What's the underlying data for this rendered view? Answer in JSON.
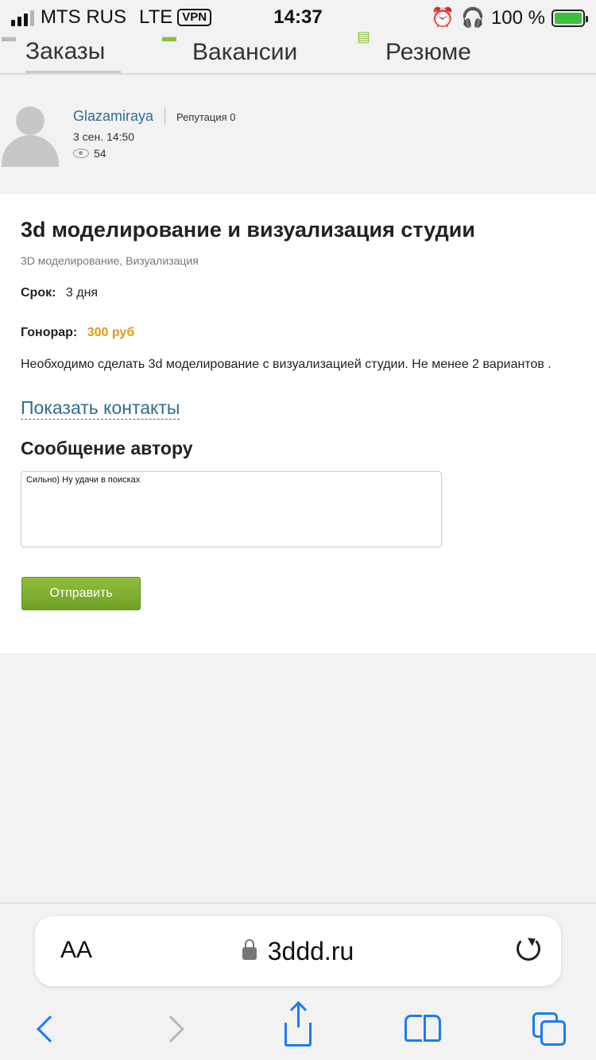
{
  "status_bar": {
    "carrier": "MTS RUS",
    "network": "LTE",
    "vpn": "VPN",
    "time": "14:37",
    "battery": "100 %"
  },
  "tabs": [
    {
      "label": "Заказы"
    },
    {
      "label": "Вакансии"
    },
    {
      "label": "Резюме"
    }
  ],
  "author": {
    "name": "Glazamiraya",
    "reputation": "Репутация 0",
    "date": "3 сен. 14:50",
    "views": "54"
  },
  "order": {
    "title": "3d моделирование и визуализация студии",
    "categories": "3D моделирование, Визуализация",
    "term_label": "Срок:",
    "term_value": "3 дня",
    "fee_label": "Гонорар:",
    "fee_value": "300 руб",
    "description": "Необходимо сделать 3d моделирование с визуализацией студии. Не менее 2 вариантов ."
  },
  "contacts_link": "Показать контакты",
  "message": {
    "title": "Сообщение автору",
    "text": "Сильно) Ну удачи в поисках",
    "send_label": "Отправить"
  },
  "safari": {
    "aa": "AA",
    "url": "3ddd.ru"
  },
  "colors": {
    "link": "#2c6e91",
    "fee": "#e09a17",
    "button": "#7aaa2c",
    "ios_blue": "#1a7cf5"
  }
}
